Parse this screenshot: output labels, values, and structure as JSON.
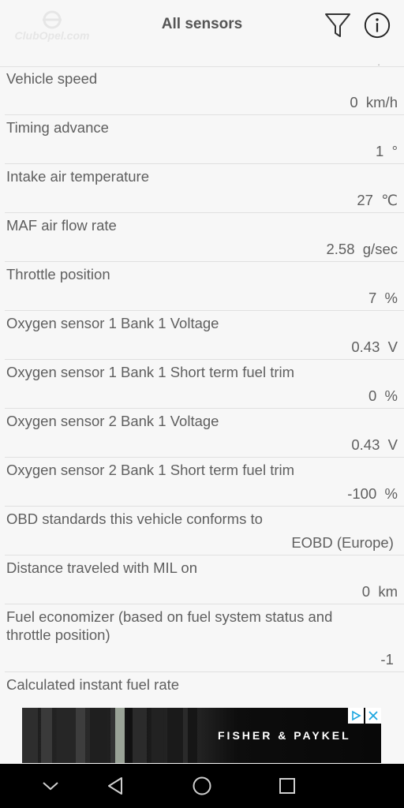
{
  "header": {
    "title": "All sensors",
    "logo_text": "ClubOpel.com",
    "filter_icon": "filter-icon",
    "info_icon": "info-icon"
  },
  "sensors": [
    {
      "label": "Vehicle speed",
      "value": "0  km/h"
    },
    {
      "label": "Timing advance",
      "value": "1  °"
    },
    {
      "label": "Intake air temperature",
      "value": "27  ℃"
    },
    {
      "label": "MAF air flow rate",
      "value": "2.58  g/sec"
    },
    {
      "label": "Throttle position",
      "value": "7  %"
    },
    {
      "label": "Oxygen sensor 1 Bank 1 Voltage",
      "value": "0.43  V"
    },
    {
      "label": "Oxygen sensor 1 Bank 1 Short term fuel trim",
      "value": "0  %"
    },
    {
      "label": "Oxygen sensor 2 Bank 1 Voltage",
      "value": "0.43  V"
    },
    {
      "label": "Oxygen sensor 2 Bank 1 Short term fuel trim",
      "value": "-100  %"
    },
    {
      "label": "OBD standards this vehicle conforms to",
      "value": "EOBD (Europe) "
    },
    {
      "label": "Distance traveled with MIL on",
      "value": "0  km"
    },
    {
      "label": "Fuel economizer (based on fuel system status and throttle position)",
      "value": "-1 "
    },
    {
      "label": "Calculated instant fuel rate",
      "value": ""
    }
  ],
  "ad": {
    "brand": "FISHER & PAYKEL",
    "adchoices_icon": "adchoices-icon",
    "close_icon": "close-icon"
  },
  "navbar": {
    "icons": [
      "chevron-down-icon",
      "back-icon",
      "home-icon",
      "recents-icon"
    ]
  },
  "colors": {
    "background": "#f7f7f7",
    "text": "#5f5f5f",
    "divider": "#e0e0e0"
  }
}
